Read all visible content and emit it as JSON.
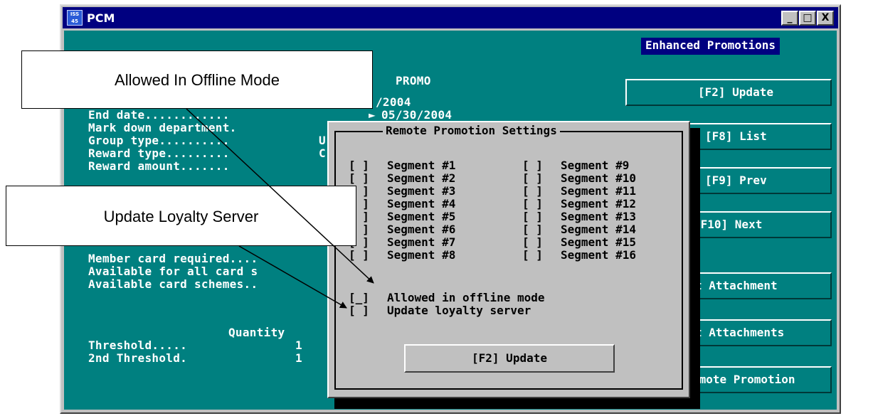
{
  "window": {
    "title": "PCM",
    "icon_text": "ISS 45",
    "minimize": "_",
    "maximize": "□",
    "close": "X"
  },
  "header": {
    "mode": "Enhanced Promotions"
  },
  "form": {
    "promo_label": "PROMO",
    "start_date_value": "/2004",
    "end_date_label": "End date............",
    "end_date_value": "05/30/2004",
    "mark_down_label": "Mark down department.",
    "group_type_label": "Group type..........",
    "group_type_value": "U",
    "reward_type_label": "Reward type.........",
    "reward_type_value": "C",
    "reward_amount_label": "Reward amount.......",
    "member_card_label": "Member card required....",
    "available_all_label": "Available for all card s",
    "available_schemes_label": "Available card schemes..",
    "quantity_header": "Quantity",
    "threshold_label": "Threshold.....",
    "threshold_value": "1",
    "threshold2_label": "2nd Threshold.",
    "threshold2_value": "1",
    "pointer": "►"
  },
  "function_buttons": [
    {
      "label": "[F2] Update"
    },
    {
      "label": "[F8] List"
    },
    {
      "label": "[F9] Prev"
    },
    {
      "label": "[F10] Next"
    },
    {
      "label": "t Attachment"
    },
    {
      "label": "t Attachments"
    },
    {
      "label": "emote Promotion"
    }
  ],
  "dialog": {
    "title": "Remote Promotion Settings",
    "checkbox": "[ ]",
    "segments_left": [
      "Segment #1",
      "Segment #2",
      "Segment #3",
      "Segment #4",
      "Segment #5",
      "Segment #6",
      "Segment #7",
      "Segment #8"
    ],
    "segments_right": [
      "Segment #9",
      "Segment #10",
      "Segment #11",
      "Segment #12",
      "Segment #13",
      "Segment #14",
      "Segment #15",
      "Segment #16"
    ],
    "offline_checkbox": "[_]",
    "offline_label": "Allowed in offline mode",
    "loyalty_checkbox": "[ ]",
    "loyalty_label": "Update loyalty server",
    "update_button": "[F2] Update"
  },
  "callouts": {
    "offline": "Allowed In Offline Mode",
    "loyalty": "Update Loyalty Server"
  }
}
